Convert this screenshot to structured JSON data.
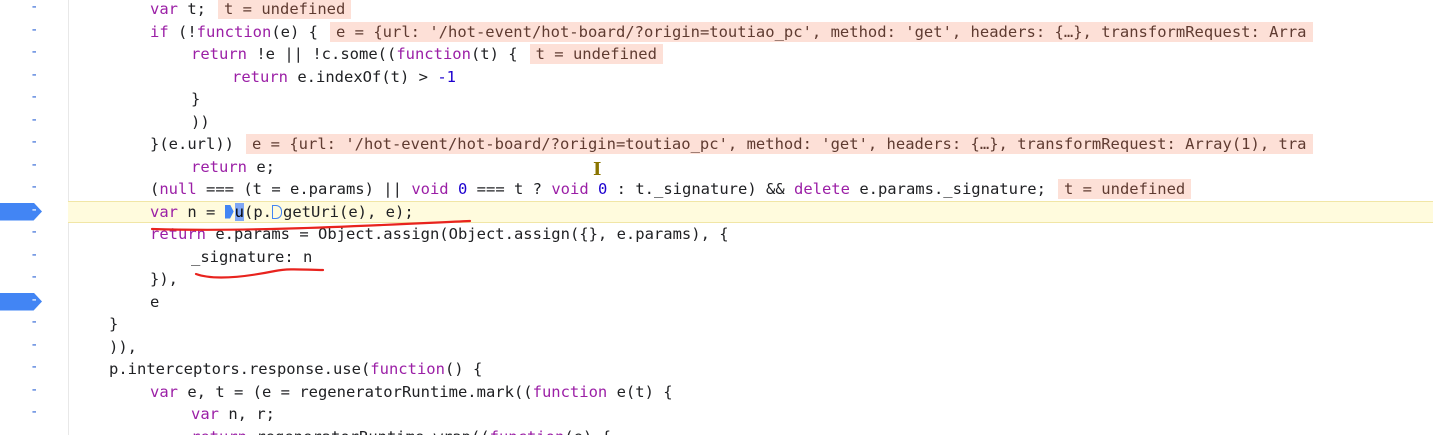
{
  "gutter": {
    "marker": "-",
    "breakpoints": [
      9,
      13
    ]
  },
  "lines": [
    {
      "code": "var t;",
      "kw": "var",
      "rest": " t;",
      "inline": "t = undefined"
    },
    {
      "code": "if (!function(e) {",
      "inline": "e = {url: '/hot-event/hot-board/?origin=toutiao_pc', method: 'get', headers: {…}, transformRequest: Arra"
    },
    {
      "code": "return !e || !c.some((function(t) {",
      "inline": "t = undefined"
    },
    {
      "code": "return e.indexOf(t) > -1"
    },
    {
      "code": "}"
    },
    {
      "code": "))"
    },
    {
      "code": "}(e.url))",
      "inline": "e = {url: '/hot-event/hot-board/?origin=toutiao_pc', method: 'get', headers: {…}, transformRequest: Array(1), tra"
    },
    {
      "code": "return e;"
    },
    {
      "code": "(null === (t = e.params) || void 0 === t ? void 0 : t._signature) && delete e.params._signature;",
      "inline": "t = undefined"
    },
    {
      "code": "var n = u(p.getUri(e), e);"
    },
    {
      "code": "return e.params = Object.assign(Object.assign({}, e.params), {"
    },
    {
      "code": "_signature: n"
    },
    {
      "code": "}),"
    },
    {
      "code": "e"
    },
    {
      "code": "}"
    },
    {
      "code": ")),"
    },
    {
      "code": "p.interceptors.response.use(function() {"
    },
    {
      "code": "var e, t = (e = regeneratorRuntime.mark((function e(t) {"
    },
    {
      "code": "var n, r;"
    },
    {
      "code": "return regeneratorRuntime.wrap((function(e) {"
    }
  ],
  "colors": {
    "current_line": "#fffbdd",
    "inline_value_bg": "#fde0d7",
    "breakpoint": "#4285f4",
    "annotation": "#e8231e"
  }
}
